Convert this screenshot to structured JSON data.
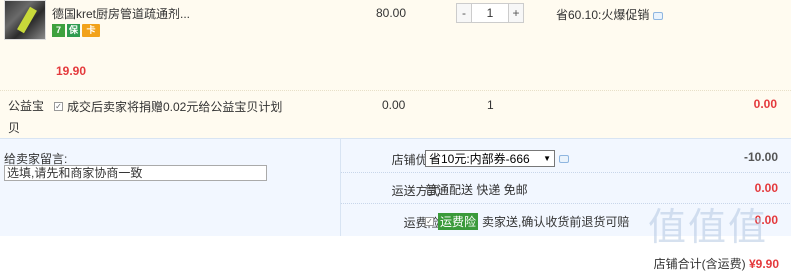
{
  "product": {
    "name": "德国kret厨房管道疏通剂...",
    "badges": [
      "7",
      "保",
      "卡"
    ],
    "unit_price": "80.00",
    "quantity": "1",
    "qty_minus": "-",
    "qty_plus": "+",
    "promo": "省60.10:火爆促销",
    "price": "19.90"
  },
  "charity": {
    "title": "公益宝贝",
    "checkbox_label": "成交后卖家将捐赠0.02元给公益宝贝计划",
    "price": "0.00",
    "quantity": "1",
    "subtotal": "0.00"
  },
  "message": {
    "label": "给卖家留言:",
    "value": "选填,请先和商家协商一致"
  },
  "shop_discount": {
    "label": "店铺优惠:",
    "selected": "省10元:内部券-666",
    "amount": "-10.00"
  },
  "shipping": {
    "label": "运送方式:",
    "value": "普通配送 快递 免邮",
    "amount": "0.00"
  },
  "insurance": {
    "label": "运费险:",
    "tag": "运费险",
    "text": "卖家送,确认收货前退货可赔",
    "amount": "0.00"
  },
  "total": {
    "label": "店铺合计(含运费)",
    "amount": "¥9.90"
  },
  "watermark": "值值值",
  "colors": {
    "accent": "#e4393c",
    "panel": "#f2f7ff",
    "row": "#fffbf0",
    "tag": "#3a9a3a"
  }
}
